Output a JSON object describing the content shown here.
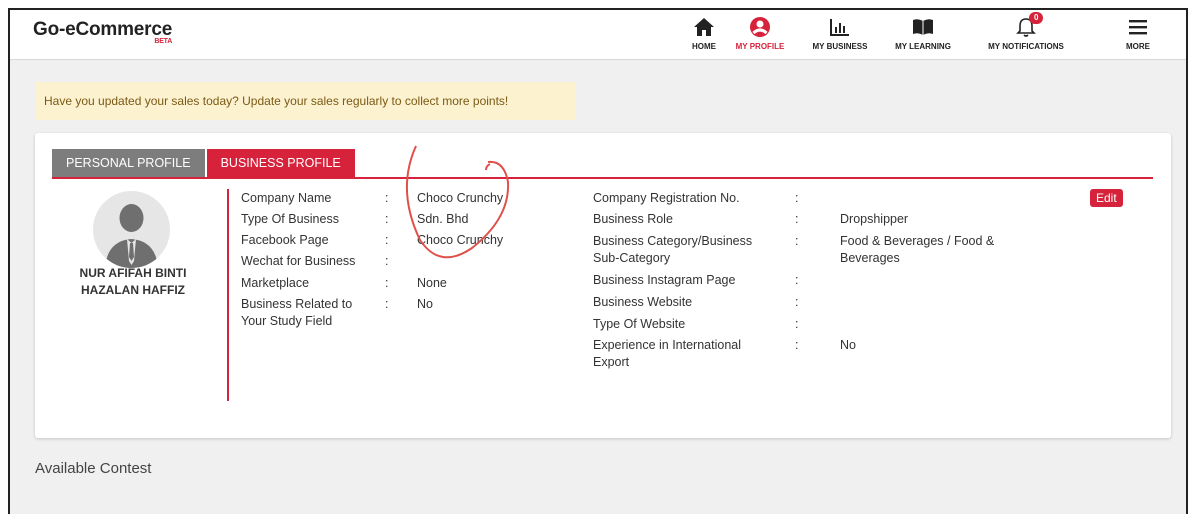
{
  "header": {
    "logo": "Go-eCommerce",
    "beta": "BETA",
    "nav": [
      {
        "label": "HOME",
        "icon": "home-icon"
      },
      {
        "label": "MY PROFILE",
        "icon": "user-icon",
        "active": true
      },
      {
        "label": "MY BUSINESS",
        "icon": "bar-chart-icon"
      },
      {
        "label": "MY LEARNING",
        "icon": "book-icon"
      },
      {
        "label": "MY NOTIFICATIONS",
        "icon": "bell-icon",
        "badge": "0"
      },
      {
        "label": "MORE",
        "icon": "menu-icon"
      }
    ]
  },
  "alert": "Have you updated your sales today? Update your sales regularly to collect more points!",
  "tabs": [
    "PERSONAL PROFILE",
    "BUSINESS PROFILE"
  ],
  "user": {
    "name_line1": "NUR AFIFAH BINTI",
    "name_line2": "HAZALAN HAFFIZ"
  },
  "left_fields": [
    {
      "label": "Company Name",
      "value": "Choco Crunchy"
    },
    {
      "label": "Type Of Business",
      "value": "Sdn. Bhd"
    },
    {
      "label": "Facebook Page",
      "value": "Choco Crunchy"
    },
    {
      "label": "Wechat for Business",
      "value": ""
    },
    {
      "label": "Marketplace",
      "value": "None"
    },
    {
      "label": "Business Related to Your Study Field",
      "value": "No"
    }
  ],
  "right_fields": [
    {
      "label": "Company Registration No.",
      "value": ""
    },
    {
      "label": "Business Role",
      "value": "Dropshipper"
    },
    {
      "label": "Business Category/Business Sub-Category",
      "value": "Food & Beverages / Food & Beverages"
    },
    {
      "label": "Business Instagram Page",
      "value": ""
    },
    {
      "label": "Business Website",
      "value": ""
    },
    {
      "label": "Type Of Website",
      "value": ""
    },
    {
      "label": "Experience in International Export",
      "value": "No"
    }
  ],
  "colon": ":",
  "edit_label": "Edit",
  "section_title": "Available Contest",
  "colors": {
    "accent": "#d6223b",
    "alert_bg": "#fdf2cf",
    "tab_inactive": "#7d7d7d"
  }
}
